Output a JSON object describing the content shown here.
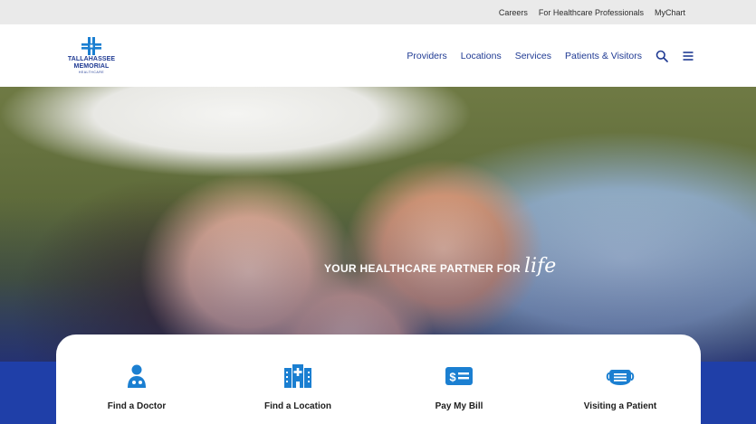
{
  "utility_links": [
    "Careers",
    "For Healthcare Professionals",
    "MyChart"
  ],
  "logo": {
    "line1": "TALLAHASSEE",
    "line2": "MEMORIAL",
    "line3": "HEALTHCARE"
  },
  "nav": {
    "items": [
      "Providers",
      "Locations",
      "Services",
      "Patients & Visitors"
    ]
  },
  "icons": {
    "search": "search-icon",
    "menu": "hamburger-menu-icon"
  },
  "hero": {
    "tagline": "YOUR HEALTHCARE PARTNER FOR",
    "tagline_script": "life"
  },
  "quick_links": [
    {
      "label": "Find a Doctor",
      "icon": "doctor-icon"
    },
    {
      "label": "Find a Location",
      "icon": "hospital-building-icon"
    },
    {
      "label": "Pay My Bill",
      "icon": "bill-icon"
    },
    {
      "label": "Visiting a Patient",
      "icon": "face-mask-icon"
    }
  ],
  "colors": {
    "brand_blue": "#1f3a93",
    "icon_blue": "#1b7fd1",
    "band_blue": "#1f3fa8"
  }
}
